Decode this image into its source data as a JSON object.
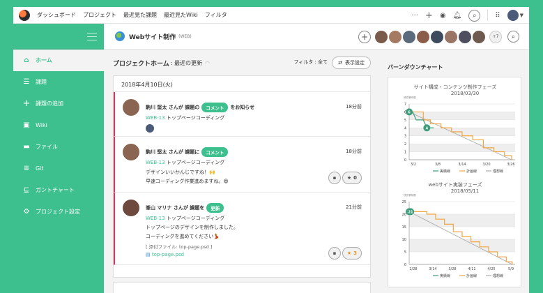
{
  "nav": {
    "links": [
      "ダッシュボード",
      "プロジェクト",
      "最近見た課題",
      "最近見たWiki",
      "フィルタ"
    ],
    "more": "···",
    "plus": "+"
  },
  "sidebar": {
    "items": [
      {
        "label": "ホーム",
        "icon": "home-icon",
        "active": true
      },
      {
        "label": "課題",
        "icon": "list-icon"
      },
      {
        "label": "課題の追加",
        "icon": "plus-icon"
      },
      {
        "label": "Wiki",
        "icon": "wiki-icon"
      },
      {
        "label": "ファイル",
        "icon": "folder-icon"
      },
      {
        "label": "Git",
        "icon": "git-icon"
      },
      {
        "label": "ガントチャート",
        "icon": "gantt-icon"
      },
      {
        "label": "プロジェクト設定",
        "icon": "gear-icon"
      }
    ],
    "git_sub": "GIT"
  },
  "header": {
    "project_name": "Webサイト制作",
    "project_key": "(WEB)",
    "more_members": "+7"
  },
  "main": {
    "title": "プロジェクトホーム",
    "subtitle": ": 最近の更新",
    "filter_text": "フィルタ : 全て",
    "display_settings": "表示設定",
    "date": "2018年4月10日(火)",
    "entries": [
      {
        "user": "駒川 堅太 さんが 課題の",
        "badge": "コメント",
        "action": "をお知らせ",
        "time": "18分前",
        "issue_key": "WEB-13",
        "issue_title": "トップページコーディング"
      },
      {
        "user": "駒川 堅太 さんが 課題に",
        "badge": "コメント",
        "time": "18分前",
        "issue_key": "WEB-13",
        "issue_title": "トップページコーディング",
        "comment_line1": "デザインいいかんじですね！🙌",
        "comment_line2": "早速コーディング作業進めますね。😄",
        "stars": "0"
      },
      {
        "user": "峯山 マリナ さんが 課題を",
        "badge": "更新",
        "time": "21分前",
        "issue_key": "WEB-13",
        "issue_title": "トップページコーディング",
        "comment_line1": "トップページのデザインを制作しました。",
        "comment_line2": "コーディングを進めてください💃",
        "attach_label": "[ 添付ファイル: top-page.psd ]",
        "file_name": "top-page.psd",
        "stars": "3"
      }
    ]
  },
  "burndown": {
    "title": "バーンダウンチャート"
  },
  "chart_data": [
    {
      "type": "line",
      "title": "サイト構成・コンテンツ制作フェーズ",
      "subtitle": "2018/03/30",
      "ylabel": "残作業時間",
      "x_ticks": [
        "3/2",
        "3/8",
        "3/14",
        "3/20",
        "3/26"
      ],
      "ylim": [
        0,
        7
      ],
      "y_ticks": [
        0,
        1,
        2,
        3,
        4,
        5,
        6,
        7
      ],
      "legend": [
        "実績線",
        "計画線",
        "理想線"
      ],
      "series": [
        {
          "name": "実績線",
          "color": "#3d9c7a",
          "x": [
            0,
            1,
            2,
            3,
            4,
            5,
            6,
            7
          ],
          "values": [
            6,
            6,
            5,
            5,
            5,
            4,
            4,
            4
          ],
          "labels": [
            [
              0,
              "6"
            ],
            [
              5,
              "4"
            ]
          ]
        },
        {
          "name": "計画線",
          "color": "#f0a540",
          "x": [
            0,
            2,
            4,
            6,
            9,
            12,
            15,
            18,
            21,
            24,
            27,
            29
          ],
          "values": [
            6,
            6,
            5,
            4.5,
            4,
            3.5,
            3,
            2.5,
            1.5,
            1,
            0.5,
            0
          ]
        },
        {
          "name": "理想線",
          "color": "#aaaaaa",
          "x": [
            0,
            29
          ],
          "values": [
            6,
            0
          ]
        }
      ],
      "x_range": [
        0,
        30
      ]
    },
    {
      "type": "line",
      "title": "webサイト実装フェーズ",
      "subtitle": "2018/05/11",
      "ylabel": "残作業時間",
      "x_ticks": [
        "2/28",
        "3/14",
        "3/28",
        "4/11",
        "4/25",
        "5/9"
      ],
      "ylim": [
        0,
        25
      ],
      "y_ticks": [
        0,
        5,
        10,
        15,
        20,
        25
      ],
      "legend": [
        "実績線",
        "計画線",
        "理想線"
      ],
      "series": [
        {
          "name": "実績線",
          "color": "#3d9c7a",
          "x": [
            0,
            1
          ],
          "values": [
            21,
            21
          ],
          "labels": [
            [
              0,
              "21"
            ],
            [
              1,
              "21"
            ]
          ]
        },
        {
          "name": "計画線",
          "color": "#f0a540",
          "x": [
            0,
            6,
            12,
            18,
            24,
            30,
            36,
            42,
            48,
            54,
            60,
            66,
            70
          ],
          "values": [
            21,
            21,
            20,
            18,
            16,
            13,
            11,
            9,
            7,
            5,
            3,
            1,
            0
          ]
        },
        {
          "name": "理想線",
          "color": "#aaaaaa",
          "x": [
            0,
            70
          ],
          "values": [
            21,
            0
          ]
        }
      ],
      "x_range": [
        0,
        72
      ]
    }
  ]
}
